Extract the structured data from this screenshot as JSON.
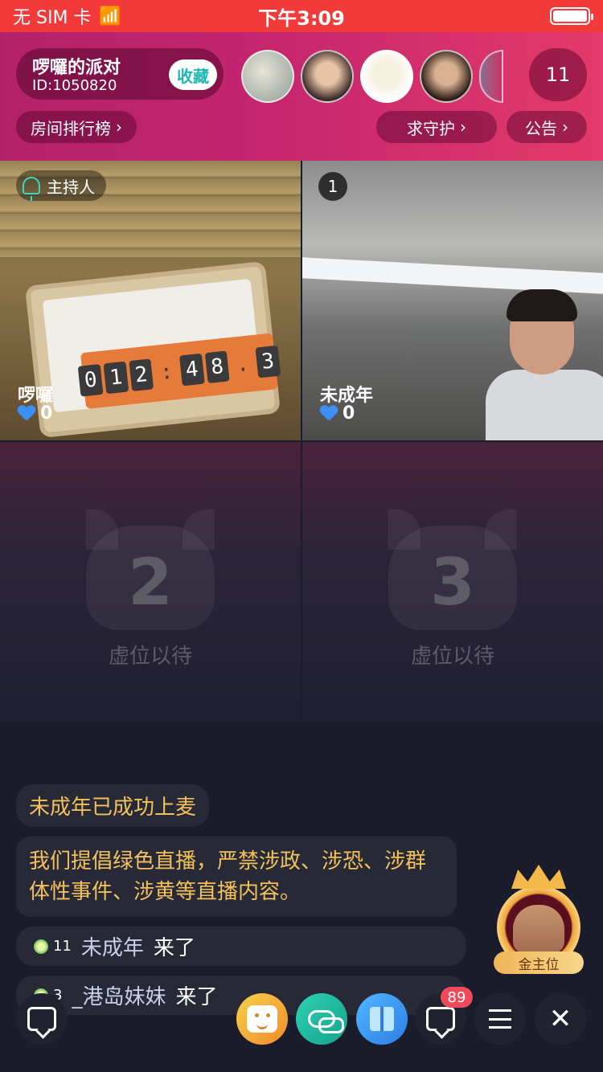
{
  "status_bar": {
    "carrier": "无 SIM 卡",
    "time": "下午3:09",
    "battery_level": 1.0
  },
  "room": {
    "name": "啰囉的派对",
    "id": "ID:1050820",
    "favorite_label": "收藏",
    "online_count": "11",
    "rank_label": "房间排行榜",
    "guard_label": "求守护",
    "notice_label": "公告"
  },
  "seats": {
    "host": {
      "tag": "主持人",
      "name": "啰囉",
      "likes": "0",
      "timer_digits": [
        "0",
        "1",
        "2",
        ":",
        "4",
        "8",
        ".",
        "3"
      ]
    },
    "seat1": {
      "number": "1",
      "name": "未成年",
      "likes": "0"
    },
    "seat2": {
      "number": "2",
      "label": "虚位以待"
    },
    "seat3": {
      "number": "3",
      "label": "虚位以待"
    }
  },
  "chat": {
    "system_message": "未成年已成功上麦",
    "notice": "我们提倡绿色直播，严禁涉政、涉恐、涉群体性事件、涉黄等直播内容。",
    "joins": [
      {
        "level": "11",
        "name": "未成年",
        "action": "来了"
      },
      {
        "level": "3",
        "name": "_港岛妹妹",
        "action": "来了"
      }
    ]
  },
  "gold_seat": {
    "label": "金主位"
  },
  "bottom_bar": {
    "message_badge": "89",
    "icons": [
      "chat-icon",
      "emoji-icon",
      "link-icon",
      "gift-icon",
      "message-icon",
      "menu-icon",
      "close-icon"
    ]
  },
  "colors": {
    "status_bar": "#f33a3a",
    "header_gradient_start": "#b2226a",
    "header_gradient_end": "#e33a6a",
    "favorite_text": "#20b7b1",
    "system_text": "#f3c15a",
    "background": "#1a1c2b"
  }
}
